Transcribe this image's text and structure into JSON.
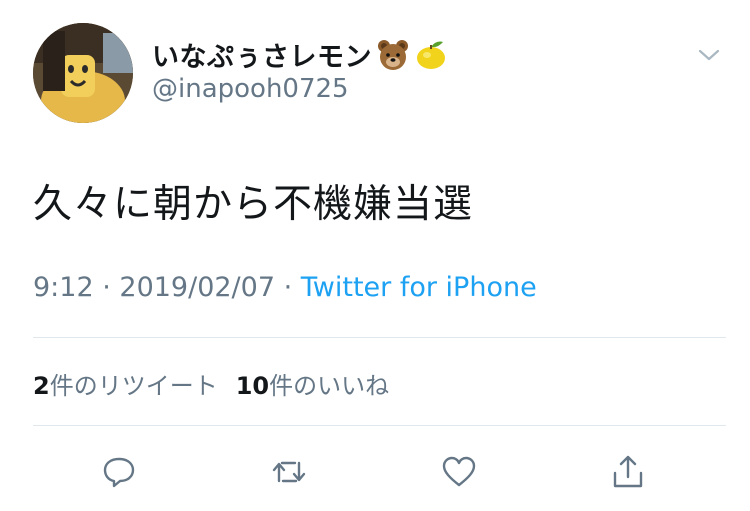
{
  "tweet": {
    "display_name": "いなぷぅさレモン",
    "display_name_emojis": [
      "bear-emoji",
      "lemon-emoji"
    ],
    "handle": "@inapooh0725",
    "text": "久々に朝から不機嫌当選",
    "time": "9:12",
    "date": "2019/02/07",
    "separator": " · ",
    "source": "Twitter for iPhone",
    "retweet_count": "2",
    "retweet_label": "件のリツイート",
    "like_count": "10",
    "like_label": "件のいいね"
  },
  "actions": {
    "icons": [
      "reply-icon",
      "retweet-icon",
      "like-icon",
      "share-icon"
    ]
  },
  "colors": {
    "text": "#14171a",
    "secondary": "#657786",
    "link": "#1da1f2",
    "divider": "#e1e8ed"
  }
}
